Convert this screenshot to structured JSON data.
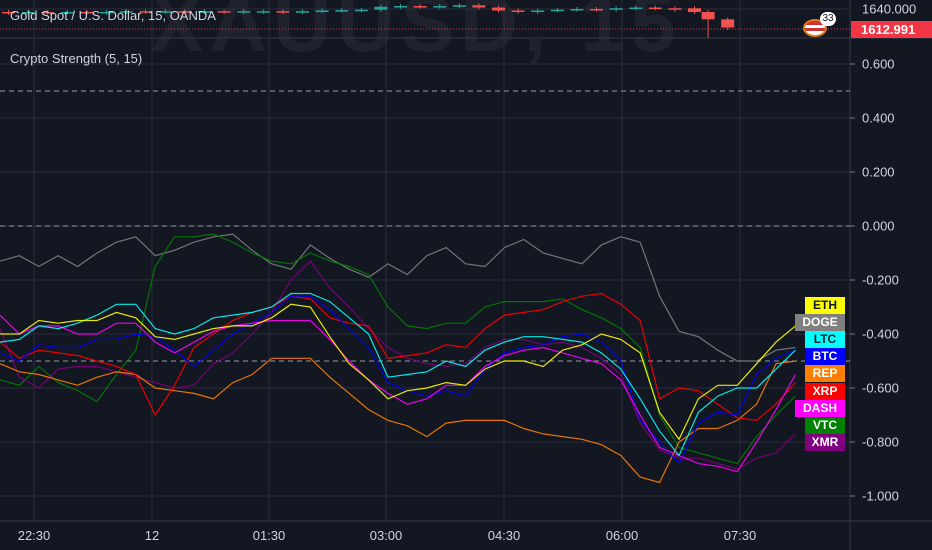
{
  "header": {
    "title": "Gold Spot / U.S. Dollar, 15, OANDA",
    "watermark": "XAUUSD, 15"
  },
  "indicator": {
    "title": "Crypto Strength (5, 15)"
  },
  "price_axis": {
    "label": "1640.000",
    "current_price": "1612.991",
    "current_color": "#f23645",
    "events_badge": "33"
  },
  "value_axis": {
    "labels": [
      "0.600",
      "0.400",
      "0.200",
      "0.000",
      "-0.200",
      "-0.400",
      "-0.600",
      "-0.800",
      "-1.000"
    ],
    "values": [
      0.6,
      0.4,
      0.2,
      0,
      -0.2,
      -0.4,
      -0.6,
      -0.8,
      -1.0
    ],
    "dashed_levels": [
      0.5,
      0,
      -0.5
    ]
  },
  "time_axis": {
    "labels": [
      "22:30",
      "12",
      "01:30",
      "03:00",
      "04:30",
      "06:00",
      "07:30"
    ]
  },
  "colors": {
    "background": "#131722",
    "grid": "#2a2e39",
    "up": "#26a69a",
    "down": "#ef5350"
  },
  "candles": [
    [
      1636,
      1635
    ],
    [
      1635,
      1636
    ],
    [
      1636,
      1635
    ],
    [
      1635,
      1636
    ],
    [
      1636,
      1635
    ],
    [
      1635,
      1636
    ],
    [
      1636,
      1637
    ],
    [
      1637,
      1636
    ],
    [
      1636,
      1637
    ],
    [
      1637,
      1636
    ],
    [
      1636,
      1637
    ],
    [
      1637,
      1636
    ],
    [
      1636,
      1637
    ],
    [
      1636,
      1637
    ],
    [
      1637,
      1636
    ],
    [
      1636,
      1637
    ],
    [
      1637,
      1638
    ],
    [
      1638,
      1638.5
    ],
    [
      1638.5,
      1639
    ],
    [
      1639,
      1643
    ],
    [
      1643,
      1644
    ],
    [
      1644,
      1643
    ],
    [
      1643,
      1644
    ],
    [
      1644,
      1645
    ],
    [
      1645,
      1642
    ],
    [
      1642,
      1638
    ],
    [
      1638,
      1636
    ],
    [
      1636,
      1638
    ],
    [
      1638,
      1639
    ],
    [
      1639,
      1640
    ],
    [
      1640,
      1639
    ],
    [
      1639,
      1641
    ],
    [
      1641,
      1642
    ],
    [
      1642,
      1641
    ],
    [
      1641,
      1639
    ],
    [
      1641,
      1636
    ],
    [
      1636,
      1626
    ],
    [
      1626,
      1615
    ]
  ],
  "legend": [
    {
      "label": "ETH",
      "bg": "#ffff00",
      "fg": "#131722"
    },
    {
      "label": "DOGE",
      "bg": "#808080",
      "fg": "#ffffff"
    },
    {
      "label": "LTC",
      "bg": "#00ffff",
      "fg": "#131722"
    },
    {
      "label": "BTC",
      "bg": "#0000ff",
      "fg": "#ffffff"
    },
    {
      "label": "REP",
      "bg": "#ff7f00",
      "fg": "#ffffff"
    },
    {
      "label": "XRP",
      "bg": "#ff0000",
      "fg": "#ffffff"
    },
    {
      "label": "DASH",
      "bg": "#ff00ff",
      "fg": "#ffffff"
    },
    {
      "label": "VTC",
      "bg": "#008000",
      "fg": "#ffffff"
    },
    {
      "label": "XMR",
      "bg": "#800080",
      "fg": "#ffffff"
    }
  ],
  "chart_data": {
    "type": "line",
    "ylim": [
      -1.1,
      0.65
    ],
    "series": [
      {
        "name": "DOGE",
        "color": "#808080",
        "values": [
          -0.13,
          -0.11,
          -0.15,
          -0.11,
          -0.15,
          -0.1,
          -0.06,
          -0.04,
          -0.11,
          -0.09,
          -0.06,
          -0.04,
          -0.03,
          -0.09,
          -0.14,
          -0.16,
          -0.07,
          -0.12,
          -0.16,
          -0.19,
          -0.14,
          -0.18,
          -0.11,
          -0.08,
          -0.14,
          -0.15,
          -0.08,
          -0.05,
          -0.1,
          -0.12,
          -0.14,
          -0.07,
          -0.04,
          -0.06,
          -0.26,
          -0.39,
          -0.41,
          -0.46,
          -0.5,
          -0.5,
          -0.46,
          -0.45
        ]
      },
      {
        "name": "VTC",
        "color": "#008000",
        "values": [
          -0.57,
          -0.59,
          -0.52,
          -0.58,
          -0.61,
          -0.65,
          -0.55,
          -0.46,
          -0.15,
          -0.04,
          -0.04,
          -0.03,
          -0.06,
          -0.1,
          -0.13,
          -0.14,
          -0.1,
          -0.13,
          -0.15,
          -0.18,
          -0.3,
          -0.37,
          -0.38,
          -0.36,
          -0.36,
          -0.3,
          -0.28,
          -0.28,
          -0.28,
          -0.27,
          -0.31,
          -0.34,
          -0.38,
          -0.45,
          -0.7,
          -0.82,
          -0.84,
          -0.86,
          -0.88,
          -0.78,
          -0.7,
          -0.63
        ]
      },
      {
        "name": "XMR",
        "color": "#800080",
        "values": [
          -0.38,
          -0.56,
          -0.6,
          -0.53,
          -0.52,
          -0.52,
          -0.54,
          -0.56,
          -0.58,
          -0.6,
          -0.59,
          -0.51,
          -0.47,
          -0.4,
          -0.32,
          -0.2,
          -0.13,
          -0.23,
          -0.3,
          -0.38,
          -0.45,
          -0.49,
          -0.51,
          -0.52,
          -0.51,
          -0.45,
          -0.42,
          -0.42,
          -0.44,
          -0.43,
          -0.45,
          -0.49,
          -0.55,
          -0.73,
          -0.83,
          -0.86,
          -0.86,
          -0.88,
          -0.9,
          -0.86,
          -0.84,
          -0.77
        ]
      },
      {
        "name": "REP",
        "color": "#ff7f00",
        "values": [
          -0.51,
          -0.54,
          -0.55,
          -0.57,
          -0.59,
          -0.56,
          -0.54,
          -0.55,
          -0.6,
          -0.61,
          -0.62,
          -0.64,
          -0.58,
          -0.55,
          -0.49,
          -0.49,
          -0.49,
          -0.56,
          -0.62,
          -0.68,
          -0.72,
          -0.74,
          -0.78,
          -0.73,
          -0.72,
          -0.72,
          -0.72,
          -0.75,
          -0.77,
          -0.78,
          -0.79,
          -0.81,
          -0.85,
          -0.93,
          -0.95,
          -0.8,
          -0.75,
          -0.75,
          -0.72,
          -0.66,
          -0.51,
          -0.5
        ]
      },
      {
        "name": "XRP",
        "color": "#ff0000",
        "values": [
          -0.43,
          -0.49,
          -0.46,
          -0.47,
          -0.48,
          -0.5,
          -0.52,
          -0.55,
          -0.7,
          -0.59,
          -0.45,
          -0.4,
          -0.35,
          -0.32,
          -0.3,
          -0.26,
          -0.27,
          -0.34,
          -0.36,
          -0.37,
          -0.49,
          -0.48,
          -0.47,
          -0.44,
          -0.45,
          -0.38,
          -0.33,
          -0.32,
          -0.31,
          -0.28,
          -0.26,
          -0.25,
          -0.29,
          -0.35,
          -0.64,
          -0.6,
          -0.61,
          -0.66,
          -0.71,
          -0.72,
          -0.66,
          -0.58
        ]
      },
      {
        "name": "BTC",
        "color": "#0000ff",
        "values": [
          -0.47,
          -0.5,
          -0.44,
          -0.45,
          -0.45,
          -0.42,
          -0.42,
          -0.4,
          -0.41,
          -0.46,
          -0.52,
          -0.46,
          -0.4,
          -0.36,
          -0.32,
          -0.26,
          -0.26,
          -0.31,
          -0.38,
          -0.45,
          -0.58,
          -0.61,
          -0.63,
          -0.61,
          -0.63,
          -0.53,
          -0.47,
          -0.45,
          -0.44,
          -0.41,
          -0.4,
          -0.43,
          -0.5,
          -0.72,
          -0.8,
          -0.88,
          -0.73,
          -0.69,
          -0.7,
          -0.55,
          -0.49,
          -0.46
        ]
      },
      {
        "name": "DASH",
        "color": "#ff00ff",
        "values": [
          -0.33,
          -0.4,
          -0.37,
          -0.37,
          -0.4,
          -0.4,
          -0.36,
          -0.36,
          -0.43,
          -0.47,
          -0.43,
          -0.39,
          -0.37,
          -0.36,
          -0.35,
          -0.35,
          -0.35,
          -0.42,
          -0.5,
          -0.57,
          -0.62,
          -0.66,
          -0.64,
          -0.59,
          -0.59,
          -0.52,
          -0.48,
          -0.46,
          -0.45,
          -0.47,
          -0.49,
          -0.51,
          -0.57,
          -0.7,
          -0.82,
          -0.85,
          -0.88,
          -0.89,
          -0.91,
          -0.8,
          -0.68,
          -0.55
        ]
      },
      {
        "name": "LTC",
        "color": "#00ffff",
        "values": [
          -0.43,
          -0.42,
          -0.37,
          -0.38,
          -0.36,
          -0.33,
          -0.29,
          -0.29,
          -0.38,
          -0.4,
          -0.38,
          -0.34,
          -0.33,
          -0.32,
          -0.3,
          -0.25,
          -0.25,
          -0.28,
          -0.34,
          -0.4,
          -0.56,
          -0.55,
          -0.54,
          -0.5,
          -0.52,
          -0.46,
          -0.43,
          -0.41,
          -0.41,
          -0.42,
          -0.43,
          -0.47,
          -0.53,
          -0.64,
          -0.76,
          -0.85,
          -0.69,
          -0.63,
          -0.6,
          -0.6,
          -0.53,
          -0.46
        ]
      },
      {
        "name": "ETH",
        "color": "#ffff00",
        "values": [
          -0.4,
          -0.4,
          -0.35,
          -0.36,
          -0.35,
          -0.35,
          -0.32,
          -0.34,
          -0.41,
          -0.42,
          -0.4,
          -0.38,
          -0.37,
          -0.37,
          -0.34,
          -0.29,
          -0.3,
          -0.41,
          -0.51,
          -0.57,
          -0.64,
          -0.61,
          -0.6,
          -0.58,
          -0.59,
          -0.53,
          -0.5,
          -0.5,
          -0.52,
          -0.46,
          -0.44,
          -0.4,
          -0.42,
          -0.47,
          -0.69,
          -0.79,
          -0.64,
          -0.59,
          -0.59,
          -0.51,
          -0.43,
          -0.37
        ]
      }
    ]
  }
}
